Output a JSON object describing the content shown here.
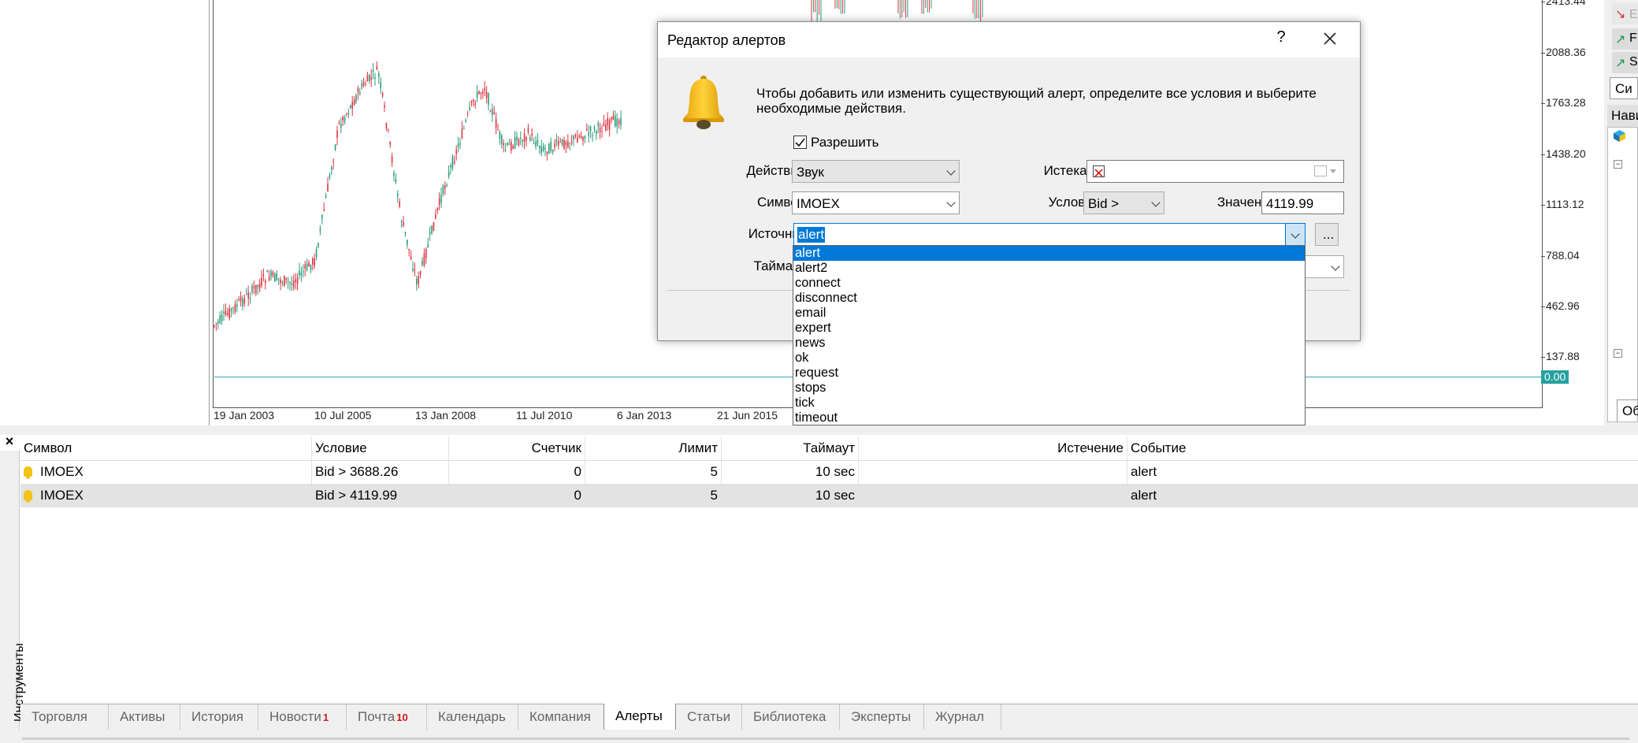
{
  "chart": {
    "y_labels": [
      "2413.44",
      "2088.36",
      "1763.28",
      "1438.20",
      "1113.12",
      "788.04",
      "462.96",
      "137.88"
    ],
    "zero_badge": "0.00",
    "x_labels": [
      "19 Jan 2003",
      "10 Jul 2005",
      "13 Jan 2008",
      "11 Jul 2010",
      "6 Jan 2013",
      "21 Jun 2015"
    ],
    "bull_color": "#2b9c7a",
    "bear_color": "#e0333f"
  },
  "right_panel": {
    "tab_top": "Си",
    "header": "Нави",
    "tab_bottom": "Об",
    "row_labels": [
      "E",
      "F",
      "S"
    ]
  },
  "dialog": {
    "title": "Редактор алертов",
    "help": "?",
    "info": "Чтобы добавить или изменить существующий алерт, определите все условия и выберите необходимые действия.",
    "enable_label": "Разрешить",
    "enable_checked": true,
    "action_label": "Действие:",
    "action_value": "Звук",
    "expires_label": "Истекает:",
    "symbol_label": "Символ:",
    "symbol_value": "IMOEX",
    "condition_label": "Условие:",
    "condition_value": "Bid >",
    "value_label": "Значение:",
    "value_value": "4119.99",
    "source_label": "Источник:",
    "source_value": "alert",
    "browse_label": "...",
    "timeout_label": "Таймаут:",
    "source_options": [
      "alert",
      "alert2",
      "connect",
      "disconnect",
      "email",
      "expert",
      "news",
      "ok",
      "request",
      "stops",
      "tick",
      "timeout"
    ],
    "selected_option": "alert"
  },
  "toolbox": {
    "close": "×",
    "side_label": "Инструменты",
    "columns": [
      "Символ",
      "Условие",
      "Счетчик",
      "Лимит",
      "Таймаут",
      "Истечение",
      "Событие"
    ],
    "rows": [
      {
        "symbol": "IMOEX",
        "condition": "Bid > 3688.26",
        "counter": "0",
        "limit": "5",
        "timeout": "10 sec",
        "expiration": "",
        "event": "alert"
      },
      {
        "symbol": "IMOEX",
        "condition": "Bid > 4119.99",
        "counter": "0",
        "limit": "5",
        "timeout": "10 sec",
        "expiration": "",
        "event": "alert"
      }
    ],
    "tabs": [
      {
        "label": "Торговля",
        "badge": ""
      },
      {
        "label": "Активы",
        "badge": ""
      },
      {
        "label": "История",
        "badge": ""
      },
      {
        "label": "Новости",
        "badge": "1"
      },
      {
        "label": "Почта",
        "badge": "10"
      },
      {
        "label": "Календарь",
        "badge": ""
      },
      {
        "label": "Компания",
        "badge": ""
      },
      {
        "label": "Алерты",
        "badge": ""
      },
      {
        "label": "Статьи",
        "badge": ""
      },
      {
        "label": "Библиотека",
        "badge": ""
      },
      {
        "label": "Эксперты",
        "badge": ""
      },
      {
        "label": "Журнал",
        "badge": ""
      }
    ],
    "active_tab": "Алерты",
    "selected_row": 1
  }
}
